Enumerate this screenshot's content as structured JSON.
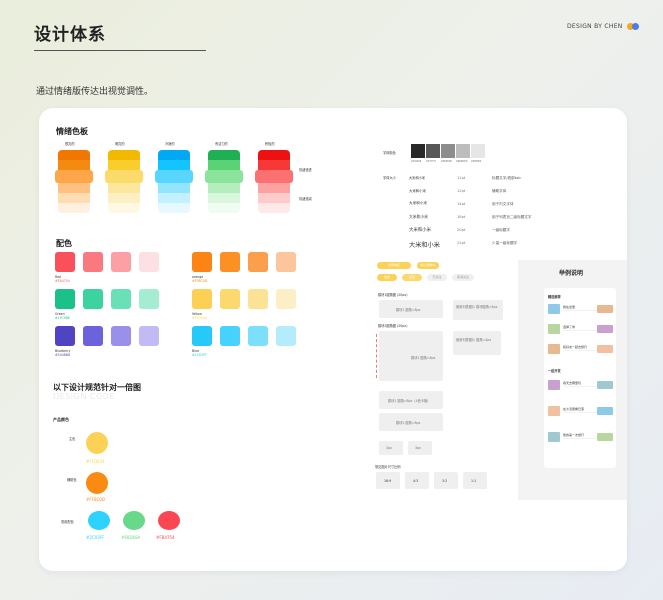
{
  "header": {
    "title": "设计体系",
    "brand": "DESIGN BY CHEN",
    "brand_dots": [
      "#f5a623",
      "#4a7cf0"
    ]
  },
  "subtitle": "通过情绪版传达出视觉调性。",
  "mood_board": {
    "heading": "情绪色板",
    "columns": [
      {
        "label": "很亮的",
        "colors": [
          "#f07800",
          "#f58a10",
          "#ffa64a",
          "#ffc080",
          "#ffdcb2",
          "#fff0df"
        ]
      },
      {
        "label": "明亮的",
        "colors": [
          "#f3b800",
          "#f9cd2c",
          "#fbdc6a",
          "#fce79c",
          "#fdf0c4",
          "#fff8e3"
        ]
      },
      {
        "label": "冷静的",
        "colors": [
          "#00a9f1",
          "#14c4ff",
          "#58d6ff",
          "#92e5ff",
          "#c3f1ff",
          "#e7f9ff"
        ]
      },
      {
        "label": "有活力的",
        "colors": [
          "#1faf55",
          "#5ad377",
          "#8be39c",
          "#b4eebf",
          "#d8f7dd",
          "#effcf1"
        ]
      },
      {
        "label": "积极的",
        "colors": [
          "#ee1111",
          "#f63838",
          "#fb7070",
          "#fda1a1",
          "#fecbcb",
          "#ffe8e8"
        ]
      }
    ],
    "side_label_top": "情绪递进",
    "side_label_bottom": "情绪递减"
  },
  "palette": {
    "heading": "配色",
    "groups": [
      {
        "name": "Red",
        "code": "#FB4754",
        "swatches": [
          "#f9505c",
          "#fa7880",
          "#fca0a6",
          "#fde0e2"
        ]
      },
      {
        "name": "Green",
        "code": "#1FC98E",
        "swatches": [
          "#1cc189",
          "#3dd3a0",
          "#6ae0b7",
          "#a4ecd2"
        ]
      },
      {
        "name": "Blueberry",
        "code": "#5448B8",
        "swatches": [
          "#4f45c3",
          "#6c62db",
          "#9990ea",
          "#c1baf3"
        ]
      },
      {
        "name": "orange",
        "code": "#FF8C0D",
        "swatches": [
          "#fb8414",
          "#fc9024",
          "#fc9f4c",
          "#fdc59b"
        ]
      },
      {
        "name": "Yellow",
        "code": "#FFD044",
        "swatches": [
          "#fbd054",
          "#fbd96f",
          "#fce294",
          "#fdefc5"
        ]
      },
      {
        "name": "Blue",
        "code": "#2CD3FF",
        "swatches": [
          "#26c9f8",
          "#46d2fb",
          "#7ce0fd",
          "#b3ecfd"
        ]
      }
    ]
  },
  "spec": {
    "heading": "以下设计规范针对一倍图",
    "watermark": "DESIGN CODE",
    "product_colors_heading": "产品颜色",
    "primary": {
      "label": "主色",
      "code": "#FFD044",
      "color": "#fcd256"
    },
    "secondary": {
      "label": "辅助色",
      "code": "#FF8C0D",
      "color": "#fb8a13"
    },
    "common": {
      "label": "常用配色",
      "items": [
        {
          "code": "#2C03FF",
          "color": "#2cd3ff"
        },
        {
          "code": "#68D68A",
          "color": "#68d98a"
        },
        {
          "code": "#FB4754",
          "color": "#fb4754"
        }
      ]
    }
  },
  "typography": {
    "gray_label": "字体颜色",
    "grays": [
      {
        "color": "#282828",
        "name": "#282828"
      },
      {
        "color": "#575757",
        "name": "#575757"
      },
      {
        "color": "#8d8d8d",
        "name": "#8D8D8D"
      },
      {
        "color": "#bdbdbd",
        "name": "#BDBDBD"
      },
      {
        "color": "#e6e6e6",
        "name": "#E6E6E6"
      }
    ],
    "size_label": "字体大小",
    "rows": [
      {
        "sample": "大米和小米",
        "pt": "11pt",
        "use": "标题文字/底部tab"
      },
      {
        "sample": "大米和小米",
        "pt": "12pt",
        "use": "辅助字体"
      },
      {
        "sample": "大米和小米",
        "pt": "14pt",
        "use": "用于内文字体"
      },
      {
        "sample": "大米和小米",
        "pt": "16pt",
        "use": "用于列表页二级标题文字"
      },
      {
        "sample": "大米和小米",
        "pt": "20pt",
        "use": "一级标题字"
      },
      {
        "sample": "大米和小米",
        "pt": "22pt",
        "use": "少量一级标题字"
      }
    ]
  },
  "components": {
    "buttons": [
      "立即购买",
      "加入购物车",
      "发送",
      "关注",
      "已关注",
      "取消关注"
    ],
    "radius_title_1": "模块1圆角图 (20px)",
    "radius_box_1": "模块1 圆角=8px",
    "radius_note_1": "使用列表图片 模块圆角=8px",
    "radius_title_2": "模块2圆角图 (20px)",
    "radius_box_2": "模块2 圆角=8px",
    "radius_note_2": "使用列表图片 圆角=4px",
    "bottom_box_1": "模块1 圆角=8px（4宫卡格）",
    "bottom_box_2": "模块2 圆角=8px",
    "small_boxes": [
      "3px",
      "3px"
    ],
    "ratio_label": "常见图片尺寸比例",
    "ratios": [
      "16:9",
      "4:3",
      "3:2",
      "1:1"
    ]
  },
  "example": {
    "heading": "举例说明",
    "section_1": "精选推荐",
    "section_2": "一起开发",
    "items": [
      "我在这里",
      "选择了你",
      "和好友一起去旅行",
      "春天去哪里玩",
      "在沙漠里看日落",
      "我的第一次旅行"
    ]
  }
}
